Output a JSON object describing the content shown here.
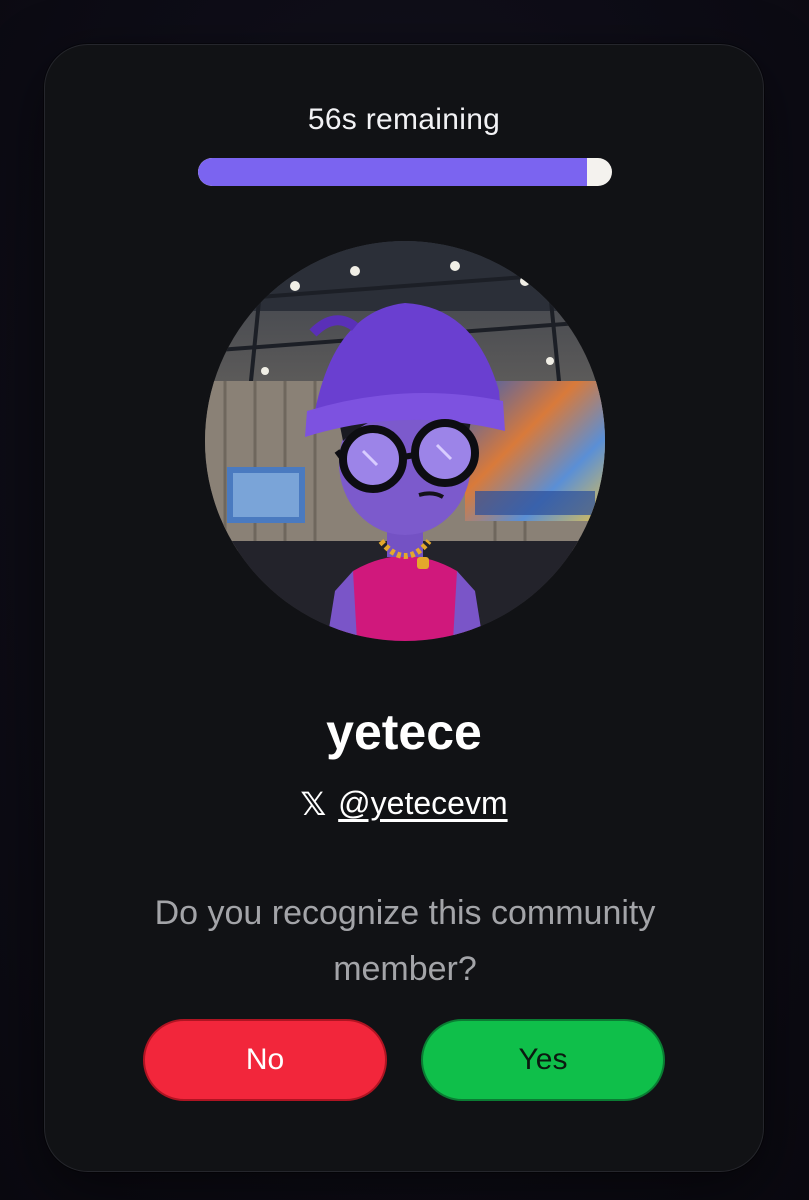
{
  "timer": {
    "label": "56s remaining",
    "progress_fraction": 0.94,
    "fill_color": "#7b64f0",
    "track_color": "#f4f2ee"
  },
  "profile": {
    "avatar_icon": "pfp-avatar-image",
    "username": "yetece",
    "social_icon": "x-logo-icon",
    "social_glyph": "𝕏",
    "handle": "@yetecevm"
  },
  "prompt": {
    "question": "Do you recognize this community member?"
  },
  "actions": {
    "no_label": "No",
    "yes_label": "Yes",
    "no_color": "#f2263b",
    "yes_color": "#0fbf4a"
  }
}
